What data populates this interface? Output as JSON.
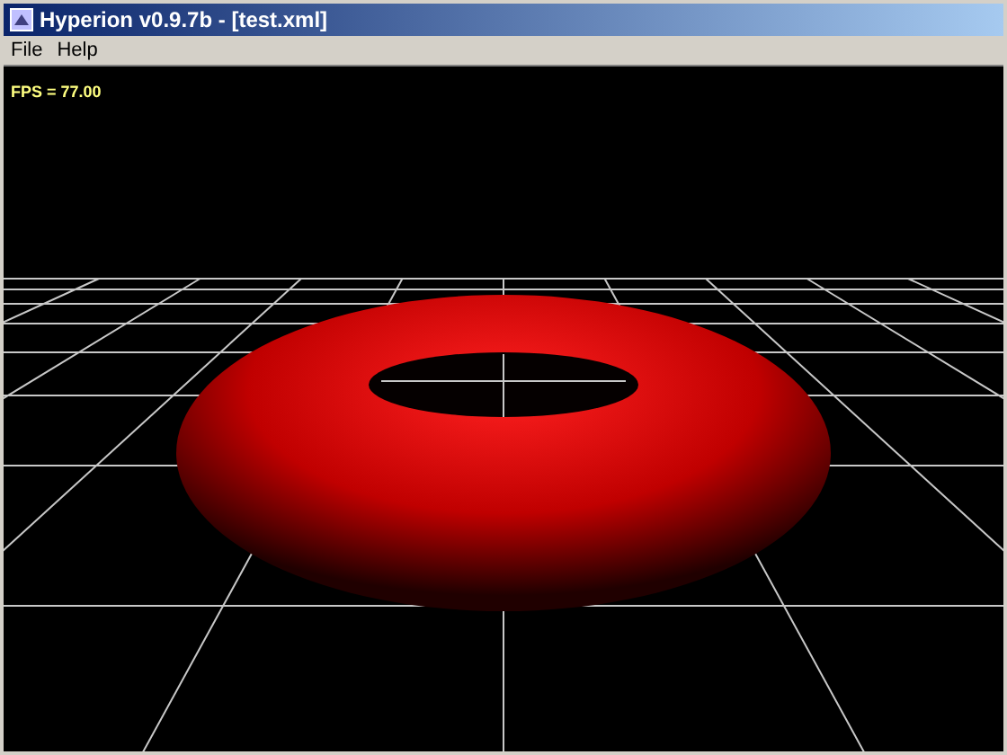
{
  "window": {
    "title": "Hyperion v0.9.7b - [test.xml]"
  },
  "menu": [
    "File",
    "Help"
  ],
  "viewport": {
    "fps": "FPS = 77.00"
  }
}
